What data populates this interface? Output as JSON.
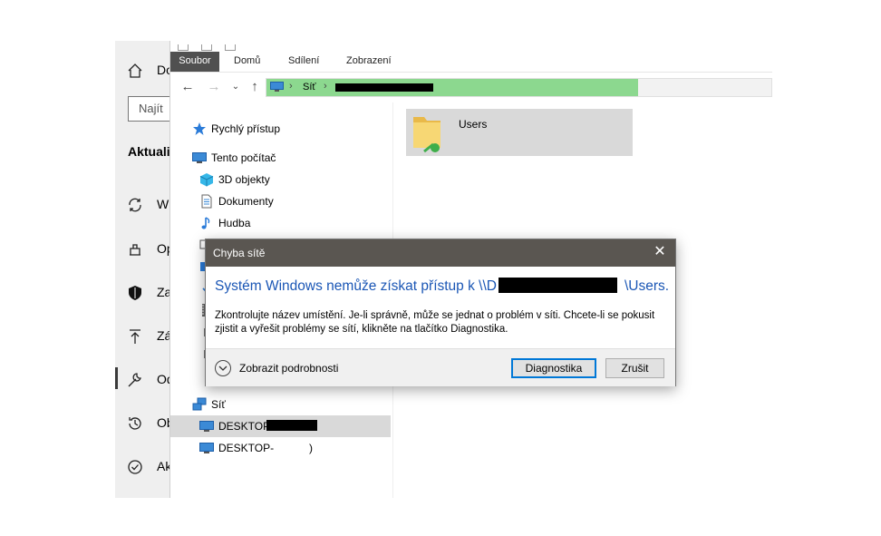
{
  "settings": {
    "home_label": "Do",
    "search_placeholder": "Najít",
    "section_heading": "Aktualiz",
    "items": [
      {
        "label": "W",
        "icon": "sync-icon"
      },
      {
        "label": "Op",
        "icon": "delivery-icon"
      },
      {
        "label": "Za",
        "icon": "shield-icon"
      },
      {
        "label": "Zá",
        "icon": "upload-icon"
      },
      {
        "label": "Od",
        "icon": "wrench-icon"
      },
      {
        "label": "Ob",
        "icon": "history-icon"
      },
      {
        "label": "Ak",
        "icon": "check-circle-icon"
      }
    ]
  },
  "explorer": {
    "tabs": [
      "Soubor",
      "Domů",
      "Sdílení",
      "Zobrazení"
    ],
    "address": {
      "crumb": "Síť"
    },
    "nav": {
      "quick_access": "Rychlý přístup",
      "this_pc": "Tento počítač",
      "objects_3d": "3D objekty",
      "documents": "Dokumenty",
      "music": "Hudba",
      "network": "Síť",
      "desktop1": "DESKTOP-",
      "desktop2": "DESKTOP-",
      "desktop2_suffix": ")"
    },
    "content": {
      "folder": "Users"
    }
  },
  "dialog": {
    "title": "Chyba sítě",
    "close": "✕",
    "main_prefix": "Systém Windows nemůže získat přístup k \\\\D",
    "main_suffix": "\\Users.",
    "body": "Zkontrolujte název umístění. Je-li správně, může se jednat o problém v síti. Chcete-li se pokusit zjistit a vyřešit problémy se sítí, klikněte na tlačítko Diagnostika.",
    "details": "Zobrazit podrobnosti",
    "diagnose": "Diagnostika",
    "cancel": "Zrušit"
  },
  "colors": {
    "accent_link": "#1a56b5",
    "address_highlight": "#8cd88f",
    "title_bar": "#5a5651"
  }
}
